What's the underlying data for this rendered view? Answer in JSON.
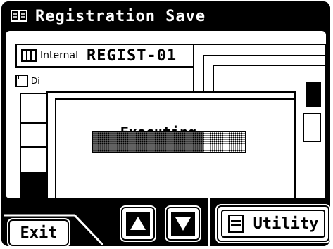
{
  "window": {
    "title": "Registration Save"
  },
  "location": {
    "source_label": "Internal",
    "name": "REGIST-01"
  },
  "disk_label": "Di",
  "dialog": {
    "message": "Executing...",
    "progress": 0.72
  },
  "buttons": {
    "exit": "Exit",
    "up": "up",
    "down": "down",
    "utility": "Utility"
  },
  "icons": [
    "registration-book-icon",
    "keyboard-icon",
    "disk-icon",
    "up-arrow-icon",
    "down-arrow-icon",
    "utility-icon"
  ]
}
